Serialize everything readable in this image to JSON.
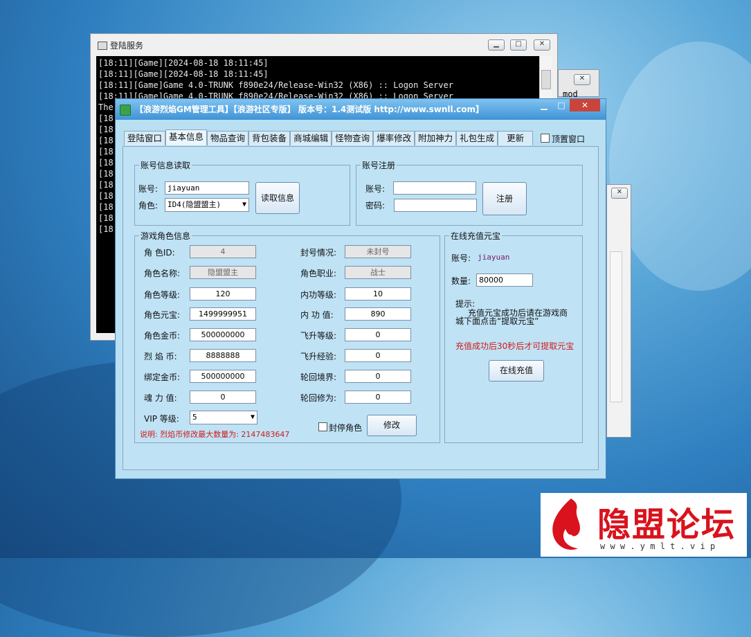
{
  "console": {
    "title": "登陆服务",
    "lines": [
      "[18:11][Game][2024-08-18 18:11:45]",
      "[18:11][Game][2024-08-18 18:11:45]",
      "[18:11][Game]Game 4.0-TRUNK f890e24/Release-Win32 (X86) :: Logon Server",
      "[18:11][Game]Game 4.0-TRUNK f890e24/Release-Win32 (X86) :: Logon Server",
      "The",
      "[18",
      "[18",
      "[18",
      "[18",
      "[18",
      "[18",
      "[18",
      "[18",
      "[18",
      "[18",
      "[18"
    ],
    "bg_text": "mod"
  },
  "gm": {
    "title": "【浪游烈焰GM管理工具】【浪游社区专版】 版本号：1.4测试版 http://www.swnll.com】",
    "tabs": [
      "登陆窗口",
      "基本信息",
      "物品查询",
      "背包装备",
      "商城编辑",
      "怪物查询",
      "爆率修改",
      "附加神力",
      "礼包生成",
      "更新"
    ],
    "topmost_label": "顶置窗口",
    "account_read": {
      "legend": "账号信息读取",
      "account_label": "账号:",
      "account_value": "jiayuan",
      "role_label": "角色:",
      "role_value": "ID4(隐盟盟主)",
      "read_button": "读取信息"
    },
    "account_reg": {
      "legend": "账号注册",
      "account_label": "账号:",
      "password_label": "密码:",
      "register_button": "注册"
    },
    "role_info": {
      "legend": "游戏角色信息",
      "left": [
        {
          "label": "角  色ID:",
          "value": "4"
        },
        {
          "label": "角色名称:",
          "value": "隐盟盟主"
        },
        {
          "label": "角色等级:",
          "value": "120"
        },
        {
          "label": "角色元宝:",
          "value": "1499999951"
        },
        {
          "label": "角色金币:",
          "value": "500000000"
        },
        {
          "label": "烈  焰  币:",
          "value": "8888888"
        },
        {
          "label": "绑定金币:",
          "value": "500000000"
        },
        {
          "label": "魂  力  值:",
          "value": "0"
        }
      ],
      "right": [
        {
          "label": "封号情况:",
          "value": "未封号"
        },
        {
          "label": "角色职业:",
          "value": "战士"
        },
        {
          "label": "内功等级:",
          "value": "10"
        },
        {
          "label": "内  功  值:",
          "value": "890"
        },
        {
          "label": "飞升等级:",
          "value": "0"
        },
        {
          "label": "飞升经验:",
          "value": "0"
        },
        {
          "label": "轮回境界:",
          "value": "0"
        },
        {
          "label": "轮回修为:",
          "value": "0"
        }
      ],
      "vip_label": "VIP 等级:",
      "vip_value": "5",
      "ban_label": "封停角色",
      "modify_button": "修改",
      "note": "说明: 烈焰币修改最大数量为: 2147483647"
    },
    "recharge": {
      "legend": "在线充值元宝",
      "account_label": "账号:",
      "account_value": "jiayuan",
      "amount_label": "数量:",
      "amount_value": "80000",
      "tip_title": "提示:",
      "tip_line1": "充值元宝成功后请在游戏商",
      "tip_line2": "城下面点击“提取元宝”",
      "warning": "充值成功后30秒后才可提取元宝",
      "recharge_button": "在线充值"
    }
  },
  "watermark": {
    "text": "隐盟论坛",
    "url": "w w w . y m l t . v i p",
    "color": "#d9121d"
  }
}
